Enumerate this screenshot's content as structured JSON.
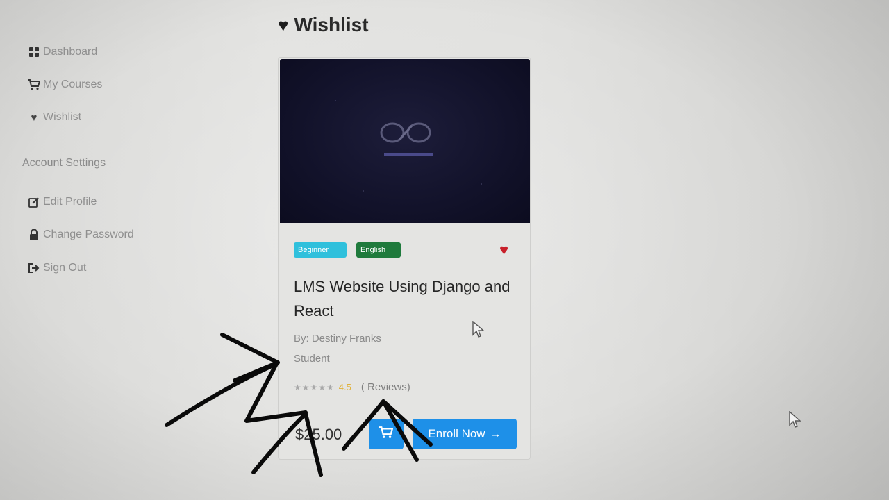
{
  "sidebar": {
    "items": [
      {
        "label": "Dashboard",
        "icon": "grid-icon"
      },
      {
        "label": "My Courses",
        "icon": "cart-icon"
      },
      {
        "label": "Wishlist",
        "icon": "heart-icon"
      }
    ],
    "account_title": "Account Settings",
    "account_items": [
      {
        "label": "Edit Profile",
        "icon": "edit-icon"
      },
      {
        "label": "Change Password",
        "icon": "lock-icon"
      },
      {
        "label": "Sign Out",
        "icon": "sign-out-icon"
      }
    ]
  },
  "page": {
    "title": "Wishlist",
    "title_icon": "heart-icon"
  },
  "course": {
    "level": "Beginner",
    "language": "English",
    "title": "LMS Website Using Django and React",
    "author": "By: Destiny Franks",
    "role": "Student",
    "stars": "★★★★★",
    "rating": "4.5",
    "reviews": "( Reviews)",
    "price": "$25.00",
    "cart_icon": "cart-icon",
    "enroll_label": "Enroll Now",
    "enroll_arrow": "→",
    "wishlist_icon": "heart-icon"
  },
  "colors": {
    "accent_blue": "#1e90e8",
    "badge_level": "#2fc0dc",
    "badge_language": "#1f7a3c",
    "heart_red": "#c8202a",
    "rating_gold": "#e0b13a"
  }
}
